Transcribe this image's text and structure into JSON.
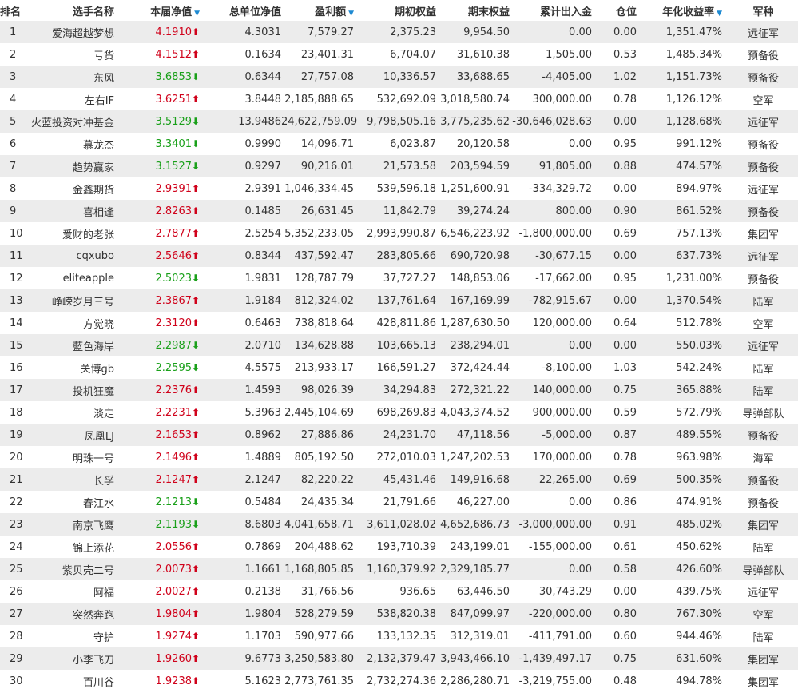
{
  "headers": {
    "rank": "排名",
    "name": "选手名称",
    "nav": "本届净值",
    "unit_nav": "总单位净值",
    "profit": "盈利额",
    "start_equity": "期初权益",
    "end_equity": "期末权益",
    "net_flow": "累计出入金",
    "position": "仓位",
    "annual_return": "年化收益率",
    "army": "军种",
    "sort_icon": "▼"
  },
  "colors": {
    "up": "#d0021b",
    "down": "#1aa01a",
    "stripe": "#ececec",
    "sort": "#1e8ad2"
  },
  "icons": {
    "up": "red-up-arrow-icon",
    "down": "green-down-arrow-icon",
    "sort": "sort-descending-icon"
  },
  "rows": [
    {
      "rank": "1",
      "name": "爱海超越梦想",
      "nav": "4.1910",
      "dir": "up",
      "arrow": "⬆",
      "unit_nav": "4.3031",
      "profit": "7,579.27",
      "start_equity": "2,375.23",
      "end_equity": "9,954.50",
      "net_flow": "0.00",
      "position": "0.00",
      "annual_return": "1,351.47%",
      "army": "远征军"
    },
    {
      "rank": "2",
      "name": "亏货",
      "nav": "4.1512",
      "dir": "up",
      "arrow": "⬆",
      "unit_nav": "0.1634",
      "profit": "23,401.31",
      "start_equity": "6,704.07",
      "end_equity": "31,610.38",
      "net_flow": "1,505.00",
      "position": "0.53",
      "annual_return": "1,485.34%",
      "army": "预备役"
    },
    {
      "rank": "3",
      "name": "东风",
      "nav": "3.6853",
      "dir": "down",
      "arrow": "⬇",
      "unit_nav": "0.6344",
      "profit": "27,757.08",
      "start_equity": "10,336.57",
      "end_equity": "33,688.65",
      "net_flow": "-4,405.00",
      "position": "1.02",
      "annual_return": "1,151.73%",
      "army": "预备役"
    },
    {
      "rank": "4",
      "name": "左右IF",
      "nav": "3.6251",
      "dir": "up",
      "arrow": "⬆",
      "unit_nav": "3.8448",
      "profit": "2,185,888.65",
      "start_equity": "532,692.09",
      "end_equity": "3,018,580.74",
      "net_flow": "300,000.00",
      "position": "0.78",
      "annual_return": "1,126.12%",
      "army": "空军"
    },
    {
      "rank": "5",
      "name": "火蓝投资对冲基金",
      "nav": "3.5129",
      "dir": "down",
      "arrow": "⬇",
      "unit_nav": "13.9486",
      "profit": "24,622,759.09",
      "start_equity": "9,798,505.16",
      "end_equity": "3,775,235.62",
      "net_flow": "-30,646,028.63",
      "position": "0.00",
      "annual_return": "1,128.68%",
      "army": "远征军"
    },
    {
      "rank": "6",
      "name": "慕龙杰",
      "nav": "3.3401",
      "dir": "down",
      "arrow": "⬇",
      "unit_nav": "0.9990",
      "profit": "14,096.71",
      "start_equity": "6,023.87",
      "end_equity": "20,120.58",
      "net_flow": "0.00",
      "position": "0.95",
      "annual_return": "991.12%",
      "army": "预备役"
    },
    {
      "rank": "7",
      "name": "趋势赢家",
      "nav": "3.1527",
      "dir": "down",
      "arrow": "⬇",
      "unit_nav": "0.9297",
      "profit": "90,216.01",
      "start_equity": "21,573.58",
      "end_equity": "203,594.59",
      "net_flow": "91,805.00",
      "position": "0.88",
      "annual_return": "474.57%",
      "army": "预备役"
    },
    {
      "rank": "8",
      "name": "金鑫期货",
      "nav": "2.9391",
      "dir": "up",
      "arrow": "⬆",
      "unit_nav": "2.9391",
      "profit": "1,046,334.45",
      "start_equity": "539,596.18",
      "end_equity": "1,251,600.91",
      "net_flow": "-334,329.72",
      "position": "0.00",
      "annual_return": "894.97%",
      "army": "远征军"
    },
    {
      "rank": "9",
      "name": "喜相逢",
      "nav": "2.8263",
      "dir": "up",
      "arrow": "⬆",
      "unit_nav": "0.1485",
      "profit": "26,631.45",
      "start_equity": "11,842.79",
      "end_equity": "39,274.24",
      "net_flow": "800.00",
      "position": "0.90",
      "annual_return": "861.52%",
      "army": "预备役"
    },
    {
      "rank": "10",
      "name": "爱财的老张",
      "nav": "2.7877",
      "dir": "up",
      "arrow": "⬆",
      "unit_nav": "2.5254",
      "profit": "5,352,233.05",
      "start_equity": "2,993,990.87",
      "end_equity": "6,546,223.92",
      "net_flow": "-1,800,000.00",
      "position": "0.69",
      "annual_return": "757.13%",
      "army": "集团军"
    },
    {
      "rank": "11",
      "name": "cqxubo",
      "nav": "2.5646",
      "dir": "up",
      "arrow": "⬆",
      "unit_nav": "0.8344",
      "profit": "437,592.47",
      "start_equity": "283,805.66",
      "end_equity": "690,720.98",
      "net_flow": "-30,677.15",
      "position": "0.00",
      "annual_return": "637.73%",
      "army": "远征军"
    },
    {
      "rank": "12",
      "name": "eliteapple",
      "nav": "2.5023",
      "dir": "down",
      "arrow": "⬇",
      "unit_nav": "1.9831",
      "profit": "128,787.79",
      "start_equity": "37,727.27",
      "end_equity": "148,853.06",
      "net_flow": "-17,662.00",
      "position": "0.95",
      "annual_return": "1,231.00%",
      "army": "预备役"
    },
    {
      "rank": "13",
      "name": "峥嵘岁月三号",
      "nav": "2.3867",
      "dir": "up",
      "arrow": "⬆",
      "unit_nav": "1.9184",
      "profit": "812,324.02",
      "start_equity": "137,761.64",
      "end_equity": "167,169.99",
      "net_flow": "-782,915.67",
      "position": "0.00",
      "annual_return": "1,370.54%",
      "army": "陆军"
    },
    {
      "rank": "14",
      "name": "方觉晓",
      "nav": "2.3120",
      "dir": "up",
      "arrow": "⬆",
      "unit_nav": "0.6463",
      "profit": "738,818.64",
      "start_equity": "428,811.86",
      "end_equity": "1,287,630.50",
      "net_flow": "120,000.00",
      "position": "0.64",
      "annual_return": "512.78%",
      "army": "空军"
    },
    {
      "rank": "15",
      "name": "藍色海岸",
      "nav": "2.2987",
      "dir": "down",
      "arrow": "⬇",
      "unit_nav": "2.0710",
      "profit": "134,628.88",
      "start_equity": "103,665.13",
      "end_equity": "238,294.01",
      "net_flow": "0.00",
      "position": "0.00",
      "annual_return": "550.03%",
      "army": "远征军"
    },
    {
      "rank": "16",
      "name": "关博gb",
      "nav": "2.2595",
      "dir": "down",
      "arrow": "⬇",
      "unit_nav": "4.5575",
      "profit": "213,933.17",
      "start_equity": "166,591.27",
      "end_equity": "372,424.44",
      "net_flow": "-8,100.00",
      "position": "1.03",
      "annual_return": "542.24%",
      "army": "陆军"
    },
    {
      "rank": "17",
      "name": "投机狂魔",
      "nav": "2.2376",
      "dir": "up",
      "arrow": "⬆",
      "unit_nav": "1.4593",
      "profit": "98,026.39",
      "start_equity": "34,294.83",
      "end_equity": "272,321.22",
      "net_flow": "140,000.00",
      "position": "0.75",
      "annual_return": "365.88%",
      "army": "陆军"
    },
    {
      "rank": "18",
      "name": "淡定",
      "nav": "2.2231",
      "dir": "up",
      "arrow": "⬆",
      "unit_nav": "5.3963",
      "profit": "2,445,104.69",
      "start_equity": "698,269.83",
      "end_equity": "4,043,374.52",
      "net_flow": "900,000.00",
      "position": "0.59",
      "annual_return": "572.79%",
      "army": "导弹部队"
    },
    {
      "rank": "19",
      "name": "凤凰LJ",
      "nav": "2.1653",
      "dir": "up",
      "arrow": "⬆",
      "unit_nav": "0.8962",
      "profit": "27,886.86",
      "start_equity": "24,231.70",
      "end_equity": "47,118.56",
      "net_flow": "-5,000.00",
      "position": "0.87",
      "annual_return": "489.55%",
      "army": "预备役"
    },
    {
      "rank": "20",
      "name": "明珠一号",
      "nav": "2.1496",
      "dir": "up",
      "arrow": "⬆",
      "unit_nav": "1.4889",
      "profit": "805,192.50",
      "start_equity": "272,010.03",
      "end_equity": "1,247,202.53",
      "net_flow": "170,000.00",
      "position": "0.78",
      "annual_return": "963.98%",
      "army": "海军"
    },
    {
      "rank": "21",
      "name": "长孚",
      "nav": "2.1247",
      "dir": "up",
      "arrow": "⬆",
      "unit_nav": "2.1247",
      "profit": "82,220.22",
      "start_equity": "45,431.46",
      "end_equity": "149,916.68",
      "net_flow": "22,265.00",
      "position": "0.69",
      "annual_return": "500.35%",
      "army": "预备役"
    },
    {
      "rank": "22",
      "name": "春江水",
      "nav": "2.1213",
      "dir": "down",
      "arrow": "⬇",
      "unit_nav": "0.5484",
      "profit": "24,435.34",
      "start_equity": "21,791.66",
      "end_equity": "46,227.00",
      "net_flow": "0.00",
      "position": "0.86",
      "annual_return": "474.91%",
      "army": "预备役"
    },
    {
      "rank": "23",
      "name": "南京飞鹰",
      "nav": "2.1193",
      "dir": "down",
      "arrow": "⬇",
      "unit_nav": "8.6803",
      "profit": "4,041,658.71",
      "start_equity": "3,611,028.02",
      "end_equity": "4,652,686.73",
      "net_flow": "-3,000,000.00",
      "position": "0.91",
      "annual_return": "485.02%",
      "army": "集团军"
    },
    {
      "rank": "24",
      "name": "锦上添花",
      "nav": "2.0556",
      "dir": "up",
      "arrow": "⬆",
      "unit_nav": "0.7869",
      "profit": "204,488.62",
      "start_equity": "193,710.39",
      "end_equity": "243,199.01",
      "net_flow": "-155,000.00",
      "position": "0.61",
      "annual_return": "450.62%",
      "army": "陆军"
    },
    {
      "rank": "25",
      "name": "紫贝壳二号",
      "nav": "2.0073",
      "dir": "up",
      "arrow": "⬆",
      "unit_nav": "1.1661",
      "profit": "1,168,805.85",
      "start_equity": "1,160,379.92",
      "end_equity": "2,329,185.77",
      "net_flow": "0.00",
      "position": "0.58",
      "annual_return": "426.60%",
      "army": "导弹部队"
    },
    {
      "rank": "26",
      "name": "阿福",
      "nav": "2.0027",
      "dir": "up",
      "arrow": "⬆",
      "unit_nav": "0.2138",
      "profit": "31,766.56",
      "start_equity": "936.65",
      "end_equity": "63,446.50",
      "net_flow": "30,743.29",
      "position": "0.00",
      "annual_return": "439.75%",
      "army": "远征军"
    },
    {
      "rank": "27",
      "name": "突然奔跑",
      "nav": "1.9804",
      "dir": "up",
      "arrow": "⬆",
      "unit_nav": "1.9804",
      "profit": "528,279.59",
      "start_equity": "538,820.38",
      "end_equity": "847,099.97",
      "net_flow": "-220,000.00",
      "position": "0.80",
      "annual_return": "767.30%",
      "army": "空军"
    },
    {
      "rank": "28",
      "name": "守护",
      "nav": "1.9274",
      "dir": "up",
      "arrow": "⬆",
      "unit_nav": "1.1703",
      "profit": "590,977.66",
      "start_equity": "133,132.35",
      "end_equity": "312,319.01",
      "net_flow": "-411,791.00",
      "position": "0.60",
      "annual_return": "944.46%",
      "army": "陆军"
    },
    {
      "rank": "29",
      "name": "小李飞刀",
      "nav": "1.9260",
      "dir": "up",
      "arrow": "⬆",
      "unit_nav": "9.6773",
      "profit": "3,250,583.80",
      "start_equity": "2,132,379.47",
      "end_equity": "3,943,466.10",
      "net_flow": "-1,439,497.17",
      "position": "0.75",
      "annual_return": "631.60%",
      "army": "集团军"
    },
    {
      "rank": "30",
      "name": "百川谷",
      "nav": "1.9238",
      "dir": "up",
      "arrow": "⬆",
      "unit_nav": "5.1623",
      "profit": "2,773,761.35",
      "start_equity": "2,732,274.36",
      "end_equity": "2,286,280.71",
      "net_flow": "-3,219,755.00",
      "position": "0.48",
      "annual_return": "494.78%",
      "army": "集团军"
    }
  ]
}
